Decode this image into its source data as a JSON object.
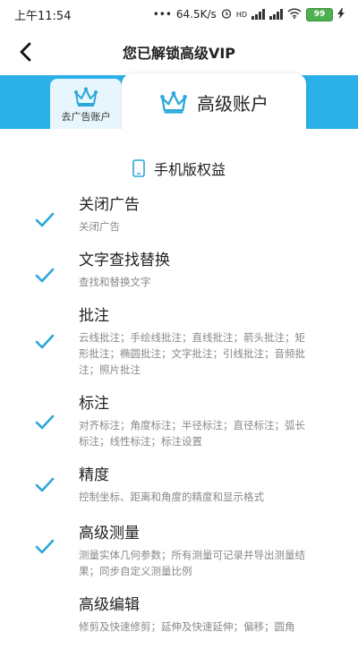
{
  "status": {
    "time": "上午11:54",
    "network_speed": "64.5K/s",
    "network_type": "HD",
    "battery": "99"
  },
  "header": {
    "title": "您已解锁高级VIP"
  },
  "tabs": {
    "ads": "去广告账户",
    "pro": "高级账户"
  },
  "section": {
    "title": "手机版权益"
  },
  "benefits": [
    {
      "title": "关闭广告",
      "desc": "关闭广告"
    },
    {
      "title": "文字查找替换",
      "desc": "查找和替换文字"
    },
    {
      "title": "批注",
      "desc": "云线批注；手绘线批注；直线批注；箭头批注；矩形批注；椭圆批注；文字批注；引线批注；音频批注；照片批注"
    },
    {
      "title": "标注",
      "desc": "对齐标注；角度标注；半径标注；直径标注；弧长标注；线性标注；标注设置"
    },
    {
      "title": "精度",
      "desc": "控制坐标、距离和角度的精度和显示格式"
    },
    {
      "title": "高级测量",
      "desc": "测量实体几何参数；所有测量可记录并导出测量结果；同步自定义测量比例"
    },
    {
      "title": "高级编辑",
      "desc": "修剪及快速修剪；延伸及快速延伸；偏移；圆角"
    }
  ],
  "colors": {
    "accent": "#2bb1e8",
    "check": "#2ba7da"
  }
}
